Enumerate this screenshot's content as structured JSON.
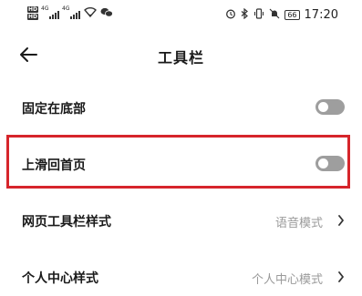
{
  "status_bar": {
    "hd1": "HD",
    "hd2": "HD",
    "net1": "4G",
    "net2": "4G",
    "battery": "66",
    "time": "17:20",
    "icons": [
      "signal-icon",
      "wifi-icon",
      "wechat-icon",
      "alarm-icon",
      "bluetooth-icon",
      "vibrate-icon",
      "mute-icon",
      "battery-icon"
    ]
  },
  "header": {
    "title": "工具栏"
  },
  "settings": [
    {
      "label": "固定在底部",
      "type": "toggle",
      "on": false
    },
    {
      "label": "上滑回首页",
      "type": "toggle",
      "on": false,
      "highlighted": true
    },
    {
      "label": "网页工具栏样式",
      "type": "select",
      "value": "语音模式"
    },
    {
      "label": "个人中心样式",
      "type": "select",
      "value": "个人中心模式"
    }
  ],
  "colors": {
    "highlight": "#d6252b",
    "toggle_off": "#9e9e9e",
    "value_text": "#9a9a9a"
  }
}
